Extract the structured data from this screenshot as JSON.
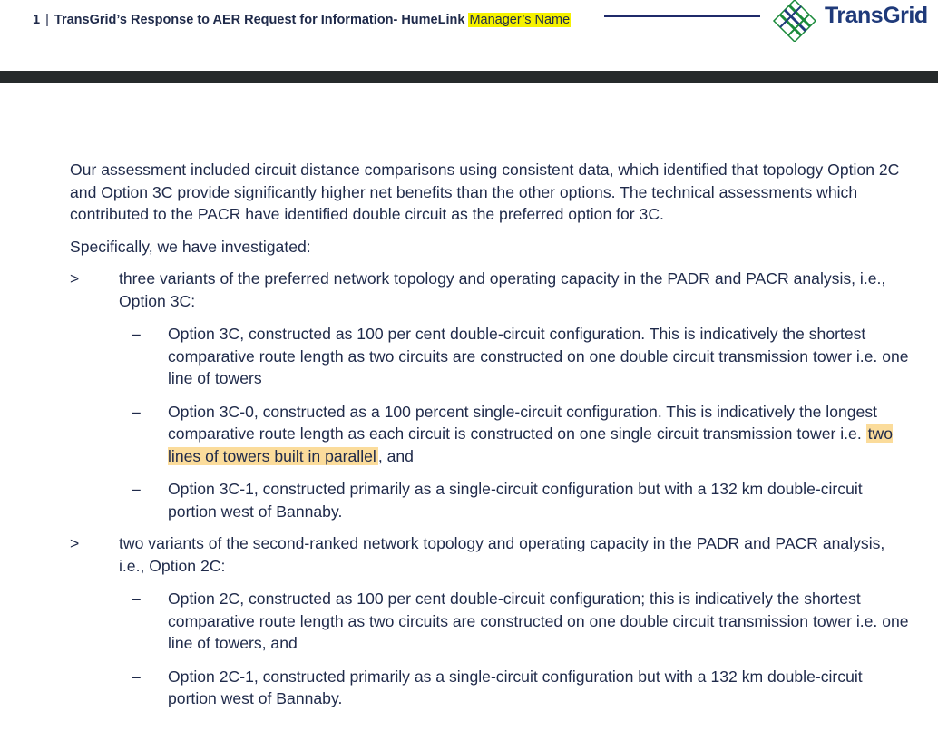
{
  "header": {
    "page_number": "1",
    "separator": "|",
    "title": "TransGrid’s Response to AER Request for Information- HumeLink",
    "manager_placeholder": "Manager’s Name",
    "logo_text": "TransGrid",
    "logo_icon": "transgrid-diamond-logo",
    "accent_color": "#1f2a6a",
    "logo_green": "#1a8a3a",
    "bar_color": "#262a2b",
    "highlight_yellow": "#f6f200",
    "highlight_orange": "#fbdc9b"
  },
  "body": {
    "intro": "Our assessment included circuit distance comparisons using consistent data, which identified that topology Option 2C and Option 3C provide significantly higher net benefits than the other options. The technical assessments which contributed to the PACR have identified double circuit as the preferred option for 3C.",
    "specifically": "Specifically, we have investigated:",
    "bullets": [
      {
        "marker": ">",
        "text": "three variants of the preferred network topology and operating capacity in the PADR and PACR analysis, i.e., Option 3C:",
        "subs": [
          {
            "marker": "–",
            "text": "Option 3C, constructed as 100 per cent double-circuit configuration. This is indicatively the shortest comparative route length as two circuits are constructed on one double circuit transmission tower i.e. one line of towers"
          },
          {
            "marker": "–",
            "text_before": "Option 3C-0, constructed as a 100 percent single-circuit configuration. This is indicatively the longest comparative route length as each circuit is constructed on one single circuit transmission tower i.e.",
            "highlight": "two lines of towers built in parallel",
            "text_after": ", and"
          },
          {
            "marker": "–",
            "text": "Option 3C-1, constructed primarily as a single-circuit configuration but with a 132 km double-circuit portion west of Bannaby."
          }
        ]
      },
      {
        "marker": ">",
        "text": "two variants of the second-ranked network topology and operating capacity in the PADR and PACR analysis, i.e., Option 2C:",
        "subs": [
          {
            "marker": "–",
            "text": "Option 2C, constructed as 100 per cent double-circuit configuration; this is indicatively the shortest comparative route length as two circuits are constructed on one double circuit transmission tower i.e. one line of towers, and"
          },
          {
            "marker": "–",
            "text": "Option 2C-1, constructed primarily as a single-circuit configuration but with a 132 km double-circuit portion west of Bannaby."
          }
        ]
      }
    ]
  }
}
